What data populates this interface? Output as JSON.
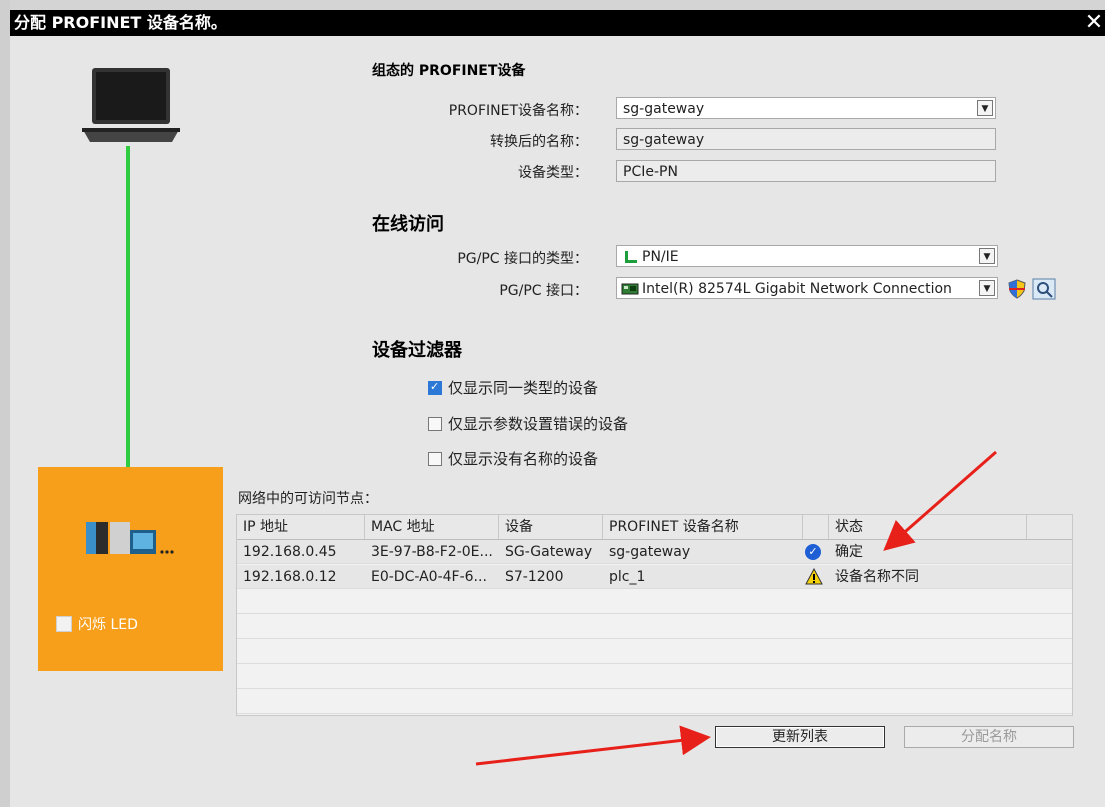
{
  "window": {
    "title": "分配 PROFINET 设备名称。",
    "close": "✕"
  },
  "configured": {
    "heading": "组态的 PROFINET设备",
    "name_label": "PROFINET设备名称：",
    "name_value": "sg-gateway",
    "converted_label": "转换后的名称：",
    "converted_value": "sg-gateway",
    "type_label": "设备类型：",
    "type_value": "PCIe-PN"
  },
  "online": {
    "heading": "在线访问",
    "iface_type_label": "PG/PC 接口的类型：",
    "iface_type_value": "PN/IE",
    "iface_label": "PG/PC 接口：",
    "iface_value": "Intel(R) 82574L Gigabit Network Connection"
  },
  "filter": {
    "heading": "设备过滤器",
    "options": [
      {
        "label": "仅显示同一类型的设备",
        "checked": true
      },
      {
        "label": "仅显示参数设置错误的设备",
        "checked": false
      },
      {
        "label": "仅显示没有名称的设备",
        "checked": false
      }
    ]
  },
  "left": {
    "led_label": "闪烁 LED"
  },
  "nodes": {
    "label": "网络中的可访问节点：",
    "columns": [
      "IP 地址",
      "MAC 地址",
      "设备",
      "PROFINET 设备名称",
      "状态"
    ],
    "rows": [
      {
        "ip": "192.168.0.45",
        "mac": "3E-97-B8-F2-0E...",
        "device": "SG-Gateway",
        "name": "sg-gateway",
        "status_icon": "check-circle-icon",
        "status": "确定"
      },
      {
        "ip": "192.168.0.12",
        "mac": "E0-DC-A0-4F-6...",
        "device": "S7-1200",
        "name": "plc_1",
        "status_icon": "warning-icon",
        "status": "设备名称不同"
      }
    ]
  },
  "buttons": {
    "update": "更新列表",
    "assign": "分配名称"
  },
  "colors": {
    "orange": "#f79f1b",
    "cable": "#2ecc40",
    "arrow": "#e8201a"
  }
}
